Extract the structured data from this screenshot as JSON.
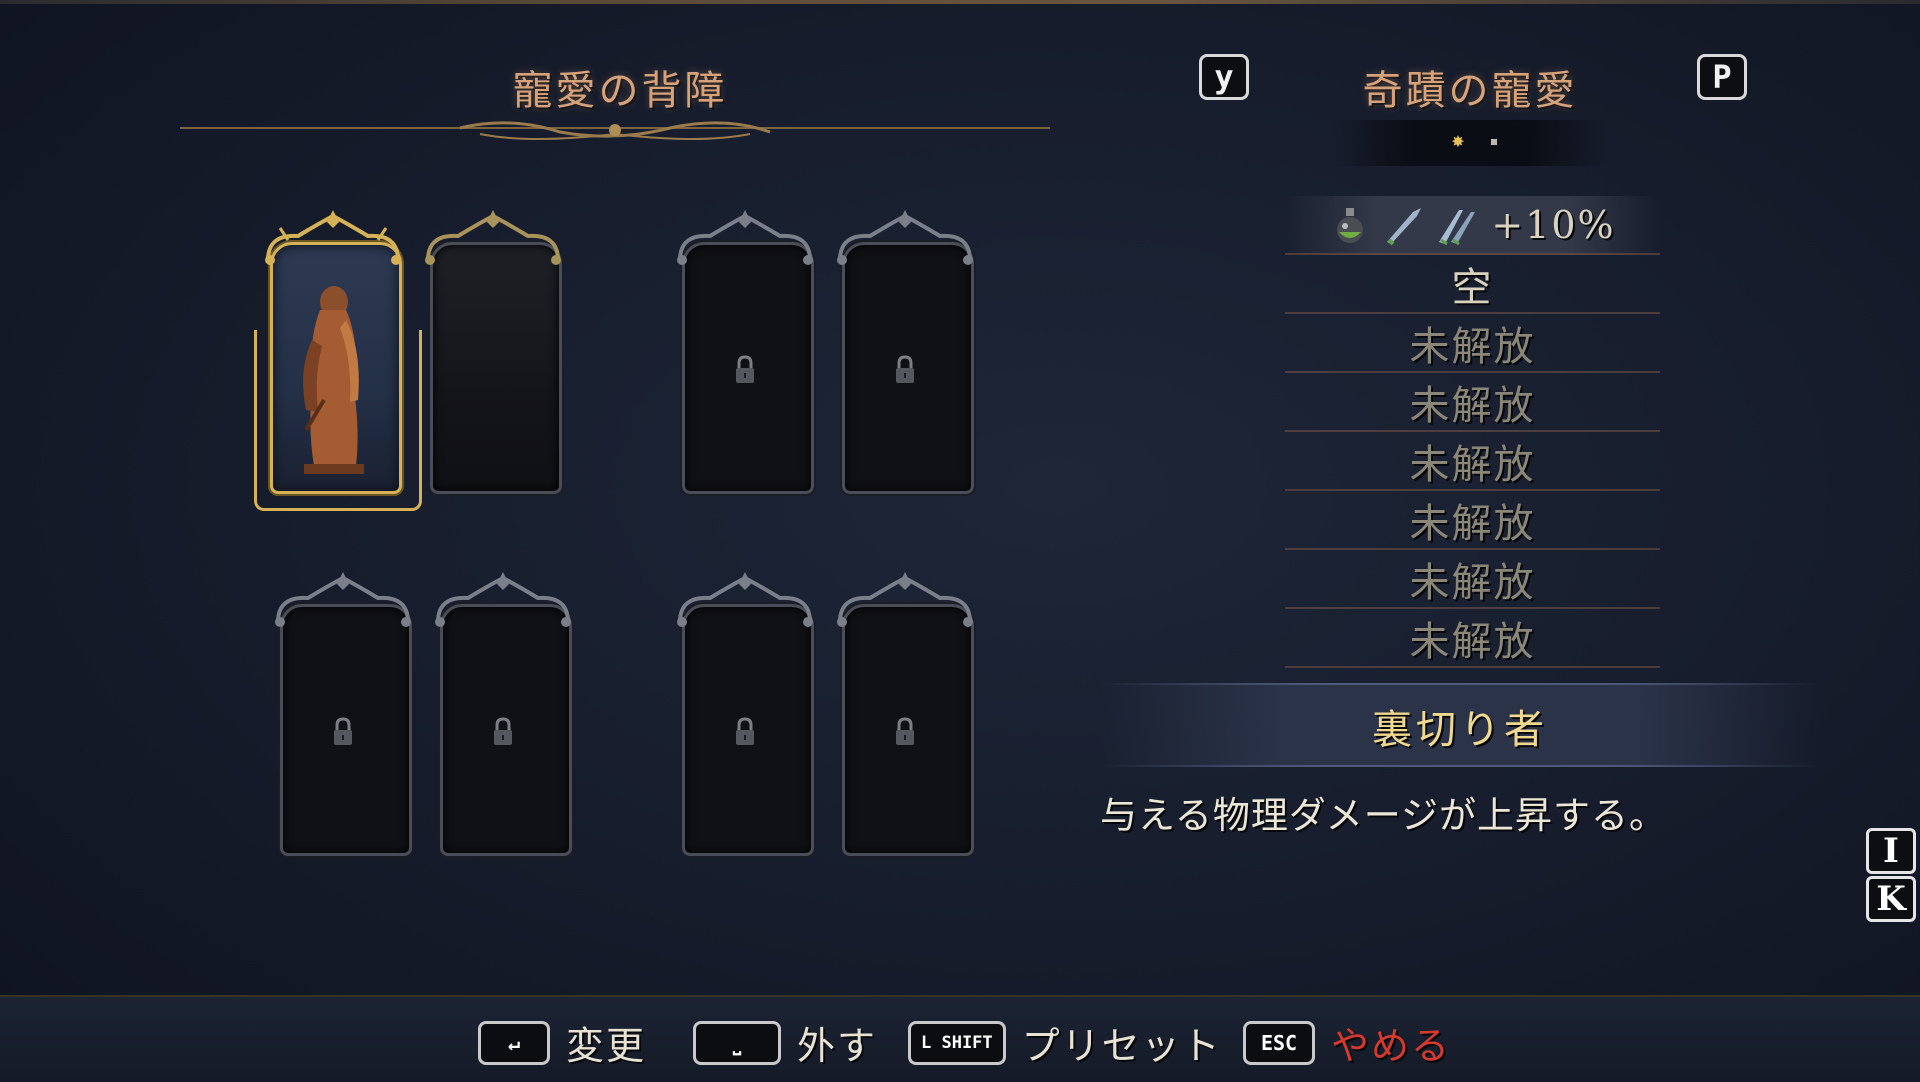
{
  "left_panel": {
    "title": "寵愛の背障",
    "frames": [
      {
        "state": "equipped",
        "item": "statue-of-betrayer"
      },
      {
        "state": "empty"
      },
      {
        "state": "locked"
      },
      {
        "state": "locked"
      },
      {
        "state": "locked"
      },
      {
        "state": "locked"
      },
      {
        "state": "locked"
      },
      {
        "state": "locked"
      }
    ]
  },
  "right_panel": {
    "prev_key": "y",
    "next_key": "P",
    "title": "奇蹟の寵愛",
    "page_indicator": {
      "current": 1,
      "total": 2
    },
    "slots": [
      {
        "icons": [
          "flask-icon",
          "blade-icon",
          "twin-blade-icon"
        ],
        "text": "+10%"
      },
      {
        "text": "空"
      },
      {
        "text": "未解放"
      },
      {
        "text": "未解放"
      },
      {
        "text": "未解放"
      },
      {
        "text": "未解放"
      },
      {
        "text": "未解放"
      },
      {
        "text": "未解放"
      }
    ],
    "selected_name": "裏切り者",
    "description": "与える物理ダメージが上昇する。",
    "side_keys": [
      "I",
      "K"
    ]
  },
  "footer": {
    "hints": [
      {
        "key": "↵",
        "label": "変更"
      },
      {
        "key": "⎵",
        "label": "外す"
      },
      {
        "key": "L SHIFT",
        "label": "プリセット"
      },
      {
        "key": "ESC",
        "label": "やめる"
      }
    ]
  },
  "colors": {
    "title": "#d6a27a",
    "gold_frame": "#d5b256",
    "selected_name": "#f0d98f",
    "cancel": "#d63a2e",
    "background": "#161c2b"
  }
}
